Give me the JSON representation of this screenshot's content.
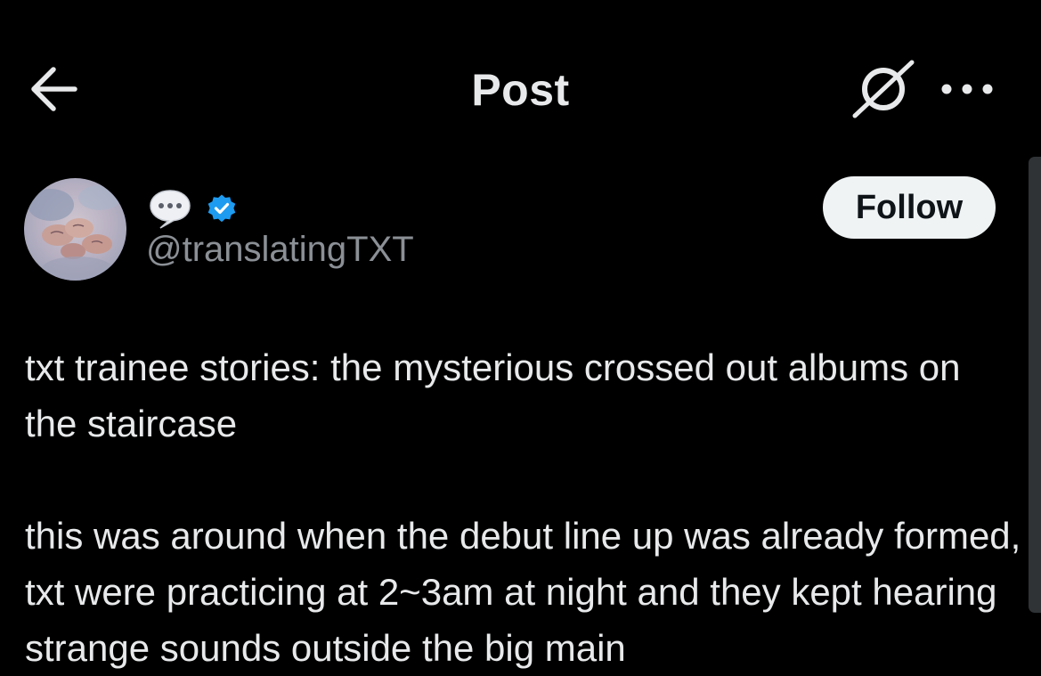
{
  "header": {
    "title": "Post",
    "back_icon": "arrow-left-icon",
    "grok_icon": "grok-slash-icon",
    "more_icon": "more-horizontal-icon"
  },
  "author": {
    "display_name_icon": "speech-bubble-emoji-icon",
    "verified_icon": "verified-badge-icon",
    "handle": "@translatingTXT",
    "follow_label": "Follow"
  },
  "post": {
    "paragraph_1": "txt trainee stories: the mysterious crossed out albums on the staircase",
    "paragraph_2": "this was around when the debut line up was already formed, txt were practicing at 2~3am at night and they kept hearing strange sounds outside the big main"
  },
  "colors": {
    "background": "#000000",
    "text": "#e7e9ea",
    "muted": "#8b9096",
    "verified": "#1d9bf0",
    "follow_bg": "#eff3f4"
  }
}
